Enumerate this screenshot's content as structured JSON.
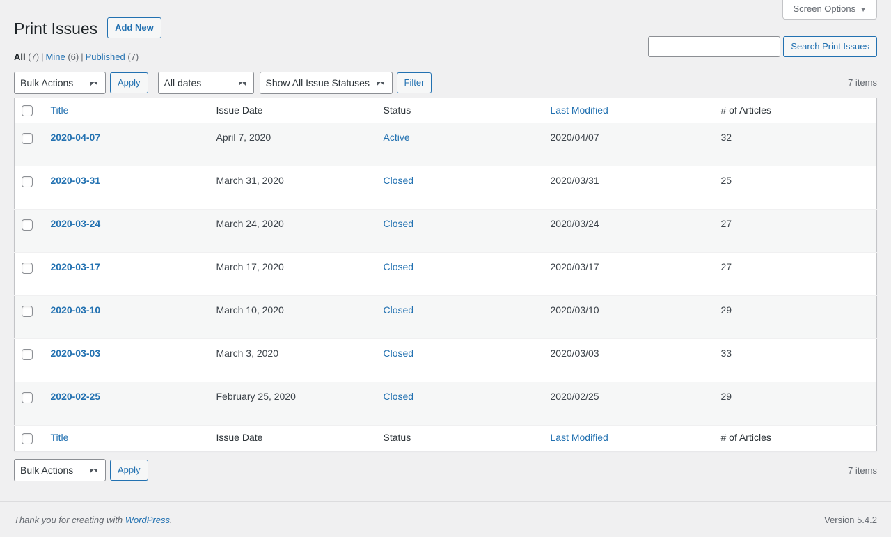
{
  "screen_meta": {
    "screen_options_label": "Screen Options",
    "arrow": "▼"
  },
  "header": {
    "title": "Print Issues",
    "add_new_label": "Add New"
  },
  "search": {
    "value": "",
    "placeholder": "",
    "submit_label": "Search Print Issues"
  },
  "views": [
    {
      "label": "All",
      "count": "(7)",
      "current": true
    },
    {
      "label": "Mine",
      "count": "(6)",
      "current": false
    },
    {
      "label": "Published",
      "count": "(7)",
      "current": false
    }
  ],
  "separator": "|",
  "tablenav_top": {
    "bulk_actions_selected": "Bulk Actions",
    "apply_label": "Apply",
    "date_selected": "All dates",
    "status_selected": "Show All Issue Statuses",
    "filter_label": "Filter",
    "displaying_num": "7 items"
  },
  "tablenav_bottom": {
    "bulk_actions_selected": "Bulk Actions",
    "apply_label": "Apply",
    "displaying_num": "7 items"
  },
  "table": {
    "columns": [
      {
        "key": "cb",
        "label": "",
        "sortable": false
      },
      {
        "key": "title",
        "label": "Title",
        "sortable": true
      },
      {
        "key": "issue_date",
        "label": "Issue Date",
        "sortable": false
      },
      {
        "key": "status",
        "label": "Status",
        "sortable": false
      },
      {
        "key": "last_modified",
        "label": "Last Modified",
        "sortable": true
      },
      {
        "key": "num_articles",
        "label": "# of Articles",
        "sortable": false
      }
    ],
    "rows": [
      {
        "title": "2020-04-07",
        "issue_date": "April 7, 2020",
        "status": "Active",
        "last_modified": "2020/04/07",
        "num_articles": "32"
      },
      {
        "title": "2020-03-31",
        "issue_date": "March 31, 2020",
        "status": "Closed",
        "last_modified": "2020/03/31",
        "num_articles": "25"
      },
      {
        "title": "2020-03-24",
        "issue_date": "March 24, 2020",
        "status": "Closed",
        "last_modified": "2020/03/24",
        "num_articles": "27"
      },
      {
        "title": "2020-03-17",
        "issue_date": "March 17, 2020",
        "status": "Closed",
        "last_modified": "2020/03/17",
        "num_articles": "27"
      },
      {
        "title": "2020-03-10",
        "issue_date": "March 10, 2020",
        "status": "Closed",
        "last_modified": "2020/03/10",
        "num_articles": "29"
      },
      {
        "title": "2020-03-03",
        "issue_date": "March 3, 2020",
        "status": "Closed",
        "last_modified": "2020/03/03",
        "num_articles": "33"
      },
      {
        "title": "2020-02-25",
        "issue_date": "February 25, 2020",
        "status": "Closed",
        "last_modified": "2020/02/25",
        "num_articles": "29"
      }
    ]
  },
  "footer": {
    "thanks_prefix": "Thank you for creating with ",
    "wordpress_link": "WordPress",
    "thanks_suffix": ".",
    "version": "Version 5.4.2"
  },
  "colors": {
    "link": "#2271b1",
    "page_bg": "#f0f0f1",
    "row_alt_bg": "#f6f7f7",
    "border": "#c3c4c7",
    "text": "#3c434a",
    "muted": "#646970"
  }
}
